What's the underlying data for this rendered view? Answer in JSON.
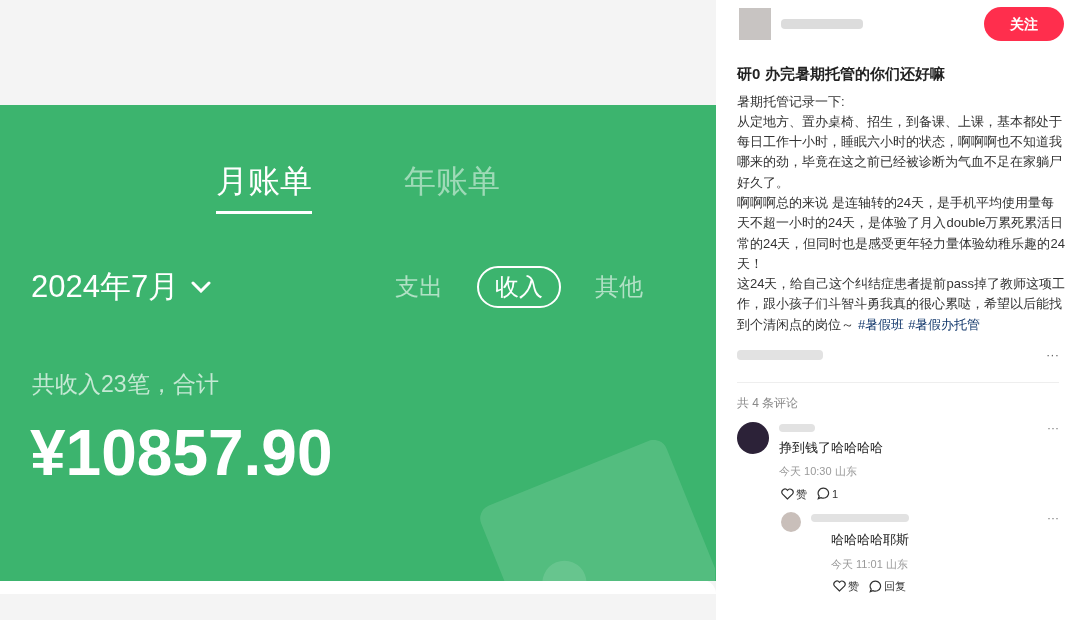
{
  "bill_screenshot": {
    "tabs": [
      {
        "label": "月账单",
        "selected": true
      },
      {
        "label": "年账单",
        "selected": false
      }
    ],
    "month": "2024年7月",
    "filters": [
      {
        "label": "支出",
        "selected": false
      },
      {
        "label": "收入",
        "selected": true
      },
      {
        "label": "其他",
        "selected": false
      }
    ],
    "summary": "共收入23笔，合计",
    "total": "¥10857.90"
  },
  "post": {
    "follow_button": "关注",
    "title": "研0 办完暑期托管的你们还好嘛",
    "paragraphs": [
      "暑期托管记录一下:",
      "从定地方、置办桌椅、招生，到备课、上课，基本都处于每日工作十小时，睡眠六小时的状态，啊啊啊也不知道我哪来的劲，毕竟在这之前已经被诊断为气血不足在家躺尸好久了。",
      "啊啊啊总的来说 是连轴转的24天，是手机平均使用量每天不超一小时的24天，是体验了月入double万累死累活日常的24天，但同时也是感受更年轻力量体验幼稚乐趣的24天！",
      "这24天，给自己这个纠结症患者提前pass掉了教师这项工作，跟小孩子们斗智斗勇我真的很心累哒，希望以后能找到个清闲点的岗位～"
    ],
    "tags": [
      "#暑假班",
      "#暑假办托管"
    ],
    "more": "···"
  },
  "comments": {
    "count": "共 4 条评论",
    "items": [
      {
        "text": "挣到钱了哈哈哈哈",
        "meta": "今天 10:30 山东",
        "like": "赞",
        "reply": "1",
        "more": "···",
        "children": [
          {
            "text": "哈哈哈哈耶斯",
            "meta": "今天 11:01 山东",
            "like": "赞",
            "reply": "回复",
            "more": "···"
          }
        ]
      }
    ]
  }
}
